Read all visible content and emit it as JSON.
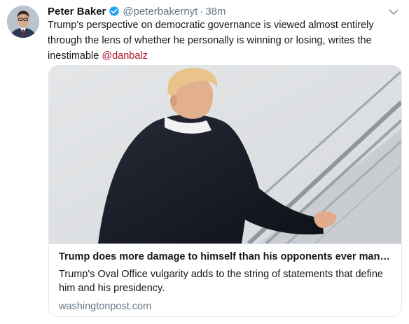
{
  "author": {
    "name": "Peter Baker",
    "handle": "@peterbakernyt",
    "separator": "·",
    "time": "38m",
    "verified": true
  },
  "tweet": {
    "text_before": "Trump's perspective on democratic governance is viewed almost entirely through the lens of whether he personally is winning or losing, writes the inestimable ",
    "mention": "@danbalz"
  },
  "card": {
    "title": "Trump does more damage to himself than his opponents ever manag...",
    "description": "Trump's Oval Office vulgarity adds to the string of statements that define him and his presidency.",
    "domain": "washingtonpost.com"
  },
  "colors": {
    "verified_badge": "#1da1f2",
    "mention": "#b0122f",
    "secondary_text": "#657786"
  },
  "icons": {
    "verified": "verified-badge-icon",
    "menu": "chevron-down-icon"
  }
}
